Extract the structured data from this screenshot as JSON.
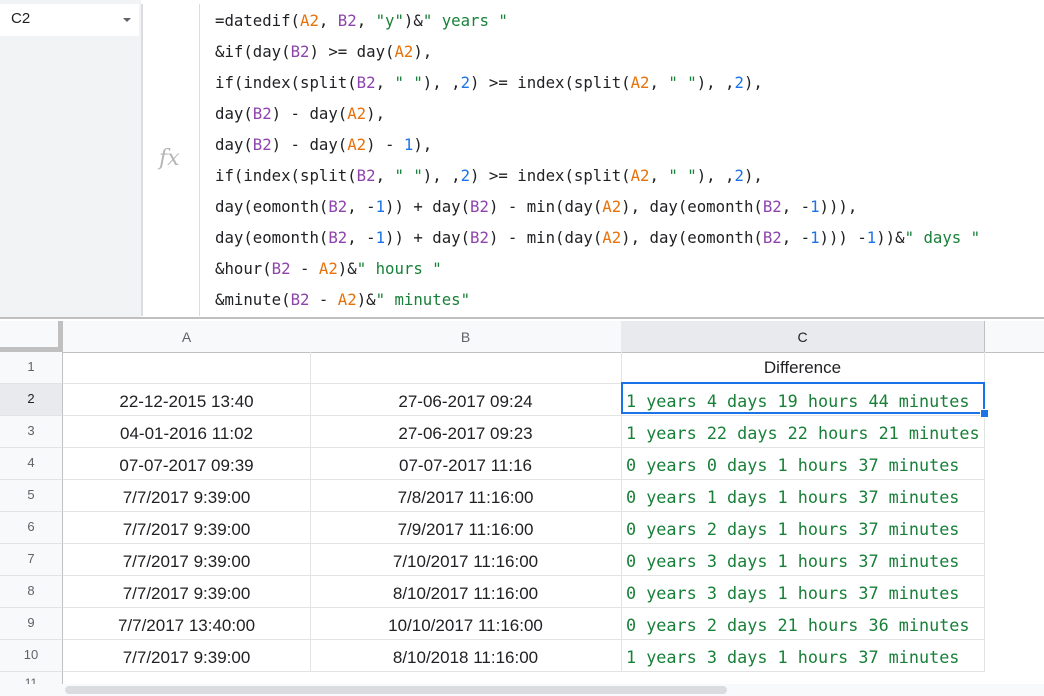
{
  "name_box": {
    "value": "C2"
  },
  "formula_bar": {
    "fx_label": "fx",
    "lines": [
      [
        [
          "t",
          "=datedif("
        ],
        [
          "a",
          "A2"
        ],
        [
          "t",
          ", "
        ],
        [
          "b",
          "B2"
        ],
        [
          "t",
          ", "
        ],
        [
          "s",
          "\"y\""
        ],
        [
          "t",
          ")&"
        ],
        [
          "s",
          "\" years \""
        ]
      ],
      [
        [
          "t",
          "&if(day("
        ],
        [
          "b",
          "B2"
        ],
        [
          "t",
          ") >= day("
        ],
        [
          "a",
          "A2"
        ],
        [
          "t",
          "),"
        ]
      ],
      [
        [
          "t",
          "if(index(split("
        ],
        [
          "b",
          "B2"
        ],
        [
          "t",
          ", "
        ],
        [
          "s",
          "\" \""
        ],
        [
          "t",
          "), ,"
        ],
        [
          "n",
          "2"
        ],
        [
          "t",
          ") >= index(split("
        ],
        [
          "a",
          "A2"
        ],
        [
          "t",
          ", "
        ],
        [
          "s",
          "\" \""
        ],
        [
          "t",
          "), ,"
        ],
        [
          "n",
          "2"
        ],
        [
          "t",
          "),"
        ]
      ],
      [
        [
          "t",
          "day("
        ],
        [
          "b",
          "B2"
        ],
        [
          "t",
          ") - day("
        ],
        [
          "a",
          "A2"
        ],
        [
          "t",
          "),"
        ]
      ],
      [
        [
          "t",
          "day("
        ],
        [
          "b",
          "B2"
        ],
        [
          "t",
          ") - day("
        ],
        [
          "a",
          "A2"
        ],
        [
          "t",
          ") - "
        ],
        [
          "n",
          "1"
        ],
        [
          "t",
          "),"
        ]
      ],
      [
        [
          "t",
          "if(index(split("
        ],
        [
          "b",
          "B2"
        ],
        [
          "t",
          ", "
        ],
        [
          "s",
          "\" \""
        ],
        [
          "t",
          "), ,"
        ],
        [
          "n",
          "2"
        ],
        [
          "t",
          ") >= index(split("
        ],
        [
          "a",
          "A2"
        ],
        [
          "t",
          ", "
        ],
        [
          "s",
          "\" \""
        ],
        [
          "t",
          "), ,"
        ],
        [
          "n",
          "2"
        ],
        [
          "t",
          "),"
        ]
      ],
      [
        [
          "t",
          "day(eomonth("
        ],
        [
          "b",
          "B2"
        ],
        [
          "t",
          ", -"
        ],
        [
          "n",
          "1"
        ],
        [
          "t",
          ")) + day("
        ],
        [
          "b",
          "B2"
        ],
        [
          "t",
          ") - min(day("
        ],
        [
          "a",
          "A2"
        ],
        [
          "t",
          "), day(eomonth("
        ],
        [
          "b",
          "B2"
        ],
        [
          "t",
          ", -"
        ],
        [
          "n",
          "1"
        ],
        [
          "t",
          ")))"
        ],
        [
          "t",
          ","
        ]
      ],
      [
        [
          "t",
          "day(eomonth("
        ],
        [
          "b",
          "B2"
        ],
        [
          "t",
          ", -"
        ],
        [
          "n",
          "1"
        ],
        [
          "t",
          ")) + day("
        ],
        [
          "b",
          "B2"
        ],
        [
          "t",
          ") - min(day("
        ],
        [
          "a",
          "A2"
        ],
        [
          "t",
          "), day(eomonth("
        ],
        [
          "b",
          "B2"
        ],
        [
          "t",
          ", -"
        ],
        [
          "n",
          "1"
        ],
        [
          "t",
          ")))"
        ],
        [
          "t",
          " -"
        ],
        [
          "n",
          "1"
        ],
        [
          "t",
          "))&"
        ],
        [
          "s",
          "\" days \""
        ]
      ],
      [
        [
          "t",
          "&hour("
        ],
        [
          "b",
          "B2"
        ],
        [
          "t",
          " - "
        ],
        [
          "a",
          "A2"
        ],
        [
          "t",
          ")&"
        ],
        [
          "s",
          "\" hours \""
        ]
      ],
      [
        [
          "t",
          "&minute("
        ],
        [
          "b",
          "B2"
        ],
        [
          "t",
          " - "
        ],
        [
          "a",
          "A2"
        ],
        [
          "t",
          ")&"
        ],
        [
          "s",
          "\" minutes\""
        ]
      ]
    ]
  },
  "grid": {
    "columns": [
      "A",
      "B",
      "C"
    ],
    "selected_column": "C",
    "selected_row": "2",
    "rows": [
      {
        "num": "1",
        "A": "",
        "B": "",
        "C": "Difference"
      },
      {
        "num": "2",
        "A": "22-12-2015  13:40",
        "B": "27-06-2017  09:24",
        "C": "1 years 4 days 19 hours 44 minutes"
      },
      {
        "num": "3",
        "A": "04-01-2016  11:02",
        "B": "27-06-2017  09:23",
        "C": "1 years 22 days 22 hours 21 minutes"
      },
      {
        "num": "4",
        "A": "07-07-2017  09:39",
        "B": "07-07-2017  11:16",
        "C": "0 years 0 days 1 hours 37 minutes"
      },
      {
        "num": "5",
        "A": "7/7/2017 9:39:00",
        "B": "7/8/2017 11:16:00",
        "C": "0 years 1 days 1 hours 37 minutes"
      },
      {
        "num": "6",
        "A": "7/7/2017 9:39:00",
        "B": "7/9/2017 11:16:00",
        "C": "0 years 2 days 1 hours 37 minutes"
      },
      {
        "num": "7",
        "A": "7/7/2017 9:39:00",
        "B": "7/10/2017 11:16:00",
        "C": "0 years 3 days 1 hours 37 minutes"
      },
      {
        "num": "8",
        "A": "7/7/2017 9:39:00",
        "B": "8/10/2017 11:16:00",
        "C": "0 years 3 days 1 hours 37 minutes"
      },
      {
        "num": "9",
        "A": "7/7/2017 13:40:00",
        "B": "10/10/2017 11:16:00",
        "C": "0 years 2 days 21 hours 36 minutes"
      },
      {
        "num": "10",
        "A": "7/7/2017 9:39:00",
        "B": "8/10/2018 11:16:00",
        "C": "1 years 3 days 1 hours 37 minutes"
      }
    ],
    "partial_row": "11"
  }
}
